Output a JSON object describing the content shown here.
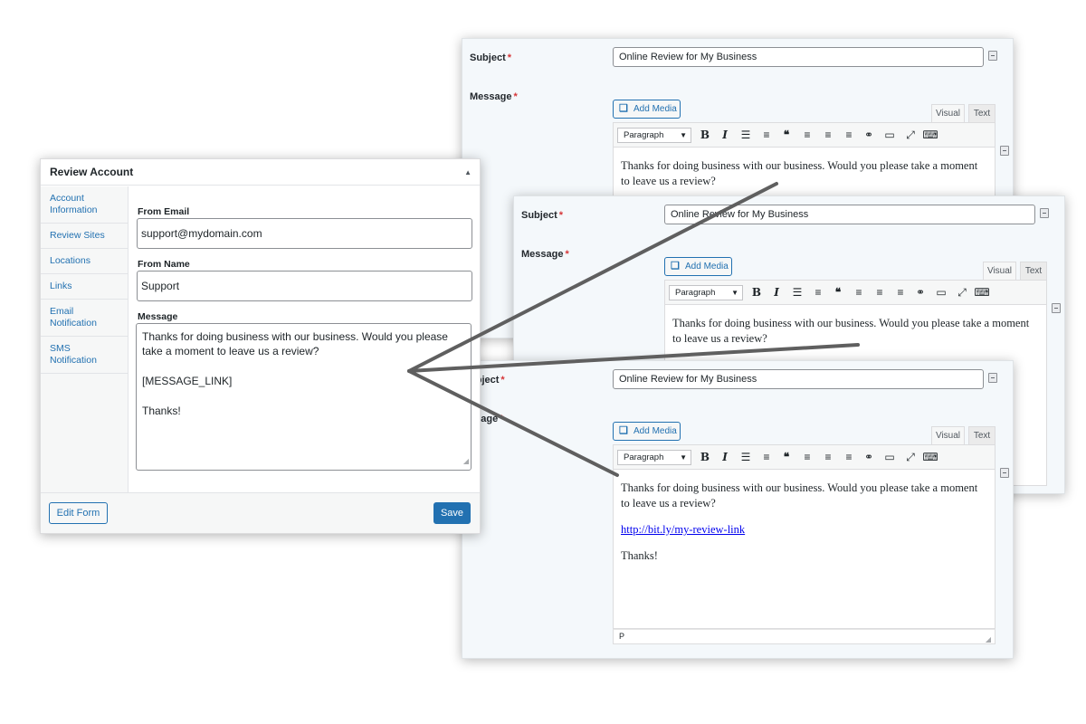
{
  "colors": {
    "link_blue": "#2271b1",
    "required_red": "#d63638",
    "arrow_gray": "#5f5f5f",
    "card_bg": "#f4f8fb"
  },
  "editor_cards": [
    {
      "subject_label": "Subject",
      "message_label": "Message",
      "required_mark": "*",
      "subject_value": "Online Review for My Business",
      "add_media_label": "Add Media",
      "tab_visual": "Visual",
      "tab_text": "Text",
      "format_select": "Paragraph",
      "body_line1": "Thanks for doing business with our business. Would you please take a moment to leave us a review?"
    },
    {
      "subject_label": "Subject",
      "message_label": "Message",
      "required_mark": "*",
      "subject_value": "Online Review for My Business",
      "add_media_label": "Add Media",
      "tab_visual": "Visual",
      "tab_text": "Text",
      "format_select": "Paragraph",
      "body_line1": "Thanks for doing business with our business. Would you please take a moment to leave us a review?"
    },
    {
      "subject_label": "ubject",
      "message_label": "ssage",
      "required_mark": "*",
      "subject_value": "Online Review for My Business",
      "add_media_label": "Add Media",
      "tab_visual": "Visual",
      "tab_text": "Text",
      "format_select": "Paragraph",
      "body_line1": "Thanks for doing business with our business. Would you please take a moment to leave us a review?",
      "body_link": "http://bit.ly/my-review-link",
      "body_closing": "Thanks!",
      "path_label": "P"
    }
  ],
  "panel": {
    "title": "Review Account",
    "nav": [
      {
        "label": "Account Information"
      },
      {
        "label": "Review Sites"
      },
      {
        "label": "Locations"
      },
      {
        "label": "Links"
      },
      {
        "label": "Email Notification"
      },
      {
        "label": "SMS Notification"
      }
    ],
    "from_email_label": "From Email",
    "from_email_value": "support@mydomain.com",
    "from_name_label": "From Name",
    "from_name_value": "Support",
    "message_label": "Message",
    "message_line1": "Thanks for doing business with our business. Would you please take a moment to leave us a review?",
    "message_line2": "[MESSAGE_LINK]",
    "message_line3": "Thanks!",
    "edit_form_label": "Edit Form",
    "save_label": "Save"
  }
}
